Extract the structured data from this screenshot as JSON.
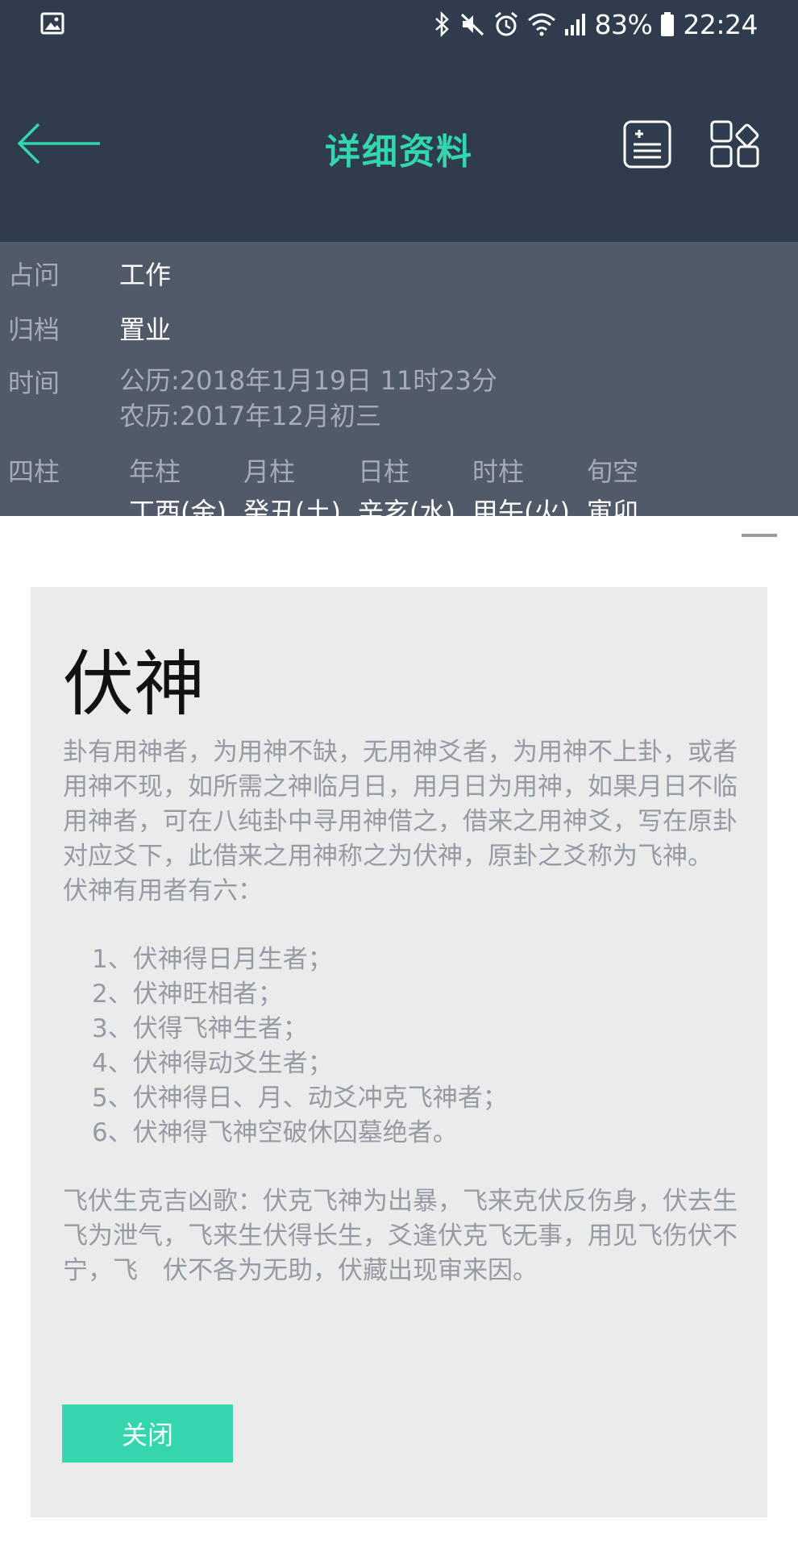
{
  "status_bar": {
    "battery": "83%",
    "time": "22:24"
  },
  "app_bar": {
    "title": "详细资料"
  },
  "info": {
    "question_label": "占问",
    "question_value": "工作",
    "archive_label": "归档",
    "archive_value": "置业",
    "time_label": "时间",
    "solar_date": "公历:2018年1月19日  11时23分",
    "lunar_date": "农历:2017年12月初三",
    "pillars_label": "四柱",
    "pillar_headers": [
      "年柱",
      "月柱",
      "日柱",
      "时柱",
      "旬空"
    ],
    "pillar_values": [
      "丁酉(金)",
      "癸丑(土)",
      "辛亥(水)",
      "甲午(火)",
      "寅卯"
    ]
  },
  "card": {
    "title": "伏神",
    "paragraph1": "卦有用神者，为用神不缺，无用神爻者，为用神不上卦，或者用神不现，如所需之神临月日，用月日为用神，如果月日不临用神者，可在八纯卦中寻用神借之，借来之用神爻，写在原卦对应爻下，此借来之用神称之为伏神，原卦之爻称为飞神。",
    "paragraph2": "伏神有用者有六：",
    "list": [
      "1、伏神得日月生者；",
      "2、伏神旺相者；",
      "3、伏得飞神生者；",
      "4、伏神得动爻生者；",
      "5、伏神得日、月、动爻冲克飞神者；",
      "6、伏神得飞神空破休囚墓绝者。"
    ],
    "paragraph3": "飞伏生克吉凶歌：伏克飞神为出暴，飞来克伏反伤身，伏去生飞为泄气，飞来生伏得长生，爻逢伏克飞无事，用见飞伤伏不宁，飞　伏不各为无助，伏藏出现审来因。",
    "close_label": "关闭"
  },
  "colors": {
    "app_bar_bg": "#2f3c4e",
    "accent": "#33d6ad",
    "info_bg": "#515a68",
    "card_bg": "#ebebeb"
  },
  "icons": {
    "status_left": "image-icon",
    "status_right": [
      "bluetooth-icon",
      "mute-icon",
      "alarm-icon",
      "wifi-icon",
      "signal-icon",
      "battery-icon"
    ],
    "app_bar": [
      "back-arrow-icon",
      "add-note-icon",
      "grid-icon"
    ]
  }
}
